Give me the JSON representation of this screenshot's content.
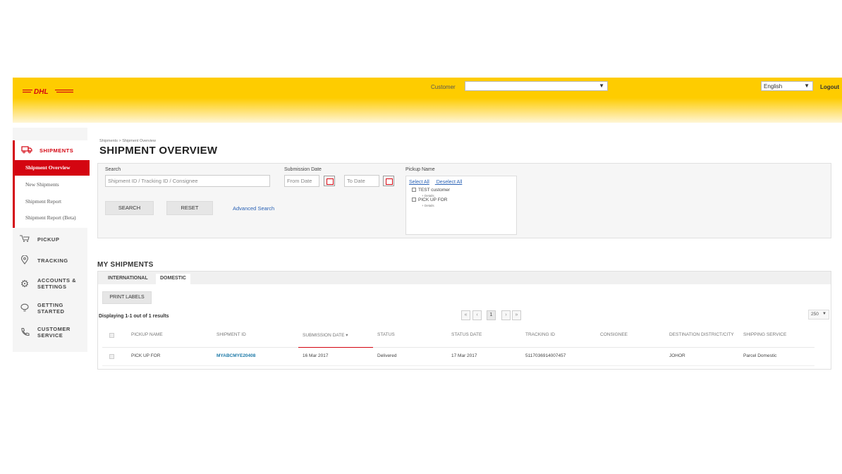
{
  "header": {
    "logo_text": "DHL",
    "customer_label": "Customer",
    "customer_value": "",
    "language_value": "English",
    "logout_label": "Logout",
    "brand_yellow": "#fecc00",
    "brand_red": "#d40511"
  },
  "sidebar": {
    "shipments": {
      "label": "SHIPMENTS",
      "icon": "truck-icon",
      "items": [
        {
          "label": "Shipment Overview",
          "active": true
        },
        {
          "label": "New Shipments"
        },
        {
          "label": "Shipment Report"
        },
        {
          "label": "Shipment Report (Beta)"
        }
      ]
    },
    "pickup": {
      "label": "PICKUP",
      "icon": "pickup-icon"
    },
    "tracking": {
      "label": "TRACKING",
      "icon": "location-pin-icon"
    },
    "accounts": {
      "label_line1": "ACCOUNTS &",
      "label_line2": "SETTINGS",
      "icon": "gear-icon"
    },
    "getting_started": {
      "label_line1": "GETTING",
      "label_line2": "STARTED",
      "icon": "lightbulb-icon"
    },
    "customer_service": {
      "label_line1": "CUSTOMER",
      "label_line2": "SERVICE",
      "icon": "phone-icon"
    }
  },
  "main": {
    "breadcrumb": "Shipments  >  Shipment Overview",
    "title": "SHIPMENT OVERVIEW",
    "search": {
      "label": "Search",
      "placeholder": "Shipment ID / Tracking ID / Consignee",
      "submission_date_label": "Submission Date",
      "from_placeholder": "From Date",
      "to_placeholder": "To Date",
      "search_button": "SEARCH",
      "reset_button": "RESET",
      "advanced_search": "Advanced Search",
      "pickup_name_label": "Pickup Name",
      "select_all": "Select All",
      "deselect_all": "Deselect All",
      "pickups": [
        {
          "name": "TEST customer",
          "detail": "+ Details"
        },
        {
          "name": "PICK UP FOR",
          "detail": "+ Details"
        }
      ]
    },
    "my_shipments": {
      "title": "MY SHIPMENTS",
      "tabs": [
        "INTERNATIONAL",
        "DOMESTIC"
      ],
      "active_tab": "DOMESTIC",
      "print_labels": "PRINT LABELS",
      "results_text": "Displaying 1-1 out of 1 results",
      "pager": {
        "first": "«",
        "prev": "‹",
        "page": "1",
        "next": "›",
        "last": "»"
      },
      "per_page": "250",
      "columns": [
        "PICKUP NAME",
        "SHIPMENT ID",
        "SUBMISSION DATE ▾",
        "STATUS",
        "STATUS DATE",
        "TRACKING ID",
        "CONSIGNEE",
        "DESTINATION DISTRICT/CITY",
        "SHIPPING SERVICE"
      ],
      "rows": [
        {
          "pickup_name": "PICK UP FOR",
          "shipment_id": "MYABCMYE20408",
          "submission_date": "16 Mar 2017",
          "status": "Delivered",
          "status_date": "17 Mar 2017",
          "tracking_id": "5117036914007457",
          "consignee": "",
          "destination": "JOHOR",
          "shipping_service": "Parcel Domestic"
        }
      ]
    }
  }
}
